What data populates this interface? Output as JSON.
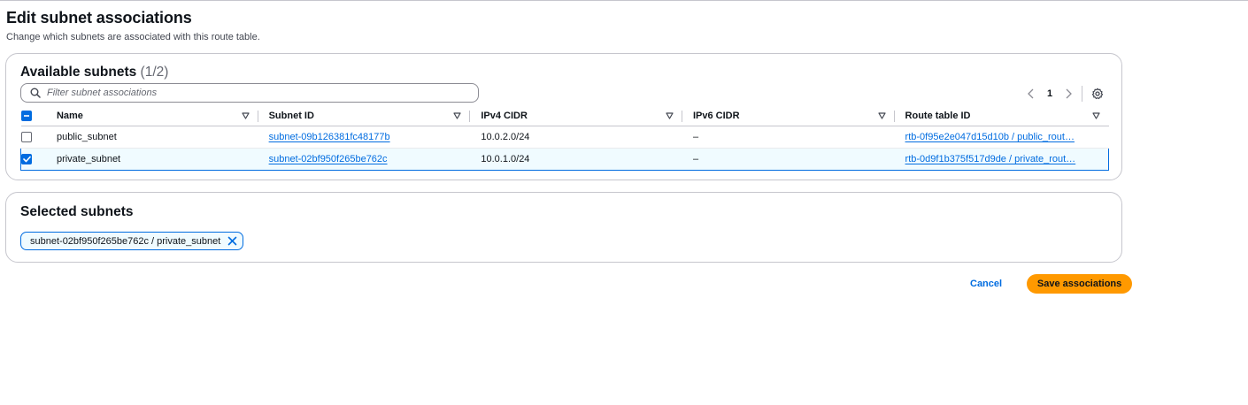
{
  "header": {
    "title": "Edit subnet associations",
    "description": "Change which subnets are associated with this route table."
  },
  "available": {
    "title": "Available subnets",
    "count": "(1/2)",
    "filter_placeholder": "Filter subnet associations",
    "pagination": {
      "current_page": "1"
    },
    "columns": [
      "Name",
      "Subnet ID",
      "IPv4 CIDR",
      "IPv6 CIDR",
      "Route table ID"
    ],
    "rows": [
      {
        "selected": false,
        "name": "public_subnet",
        "subnet_id": "subnet-09b126381fc48177b",
        "ipv4": "10.0.2.0/24",
        "ipv6": "–",
        "route_table": "rtb-0f95e2e047d15d10b / public_rout…"
      },
      {
        "selected": true,
        "name": "private_subnet",
        "subnet_id": "subnet-02bf950f265be762c",
        "ipv4": "10.0.1.0/24",
        "ipv6": "–",
        "route_table": "rtb-0d9f1b375f517d9de / private_rout…"
      }
    ]
  },
  "selected": {
    "title": "Selected subnets",
    "chips": [
      "subnet-02bf950f265be762c / private_subnet"
    ]
  },
  "actions": {
    "cancel_label": "Cancel",
    "save_label": "Save associations"
  },
  "colors": {
    "link": "#006ce0",
    "primary_button": "#ff9900",
    "selected_row_bg": "#f0fbff"
  },
  "icons": {
    "search": "search-icon",
    "sort": "sort-down-icon",
    "prev": "chevron-left-icon",
    "next": "chevron-right-icon",
    "settings": "gear-icon",
    "dismiss": "close-icon"
  }
}
